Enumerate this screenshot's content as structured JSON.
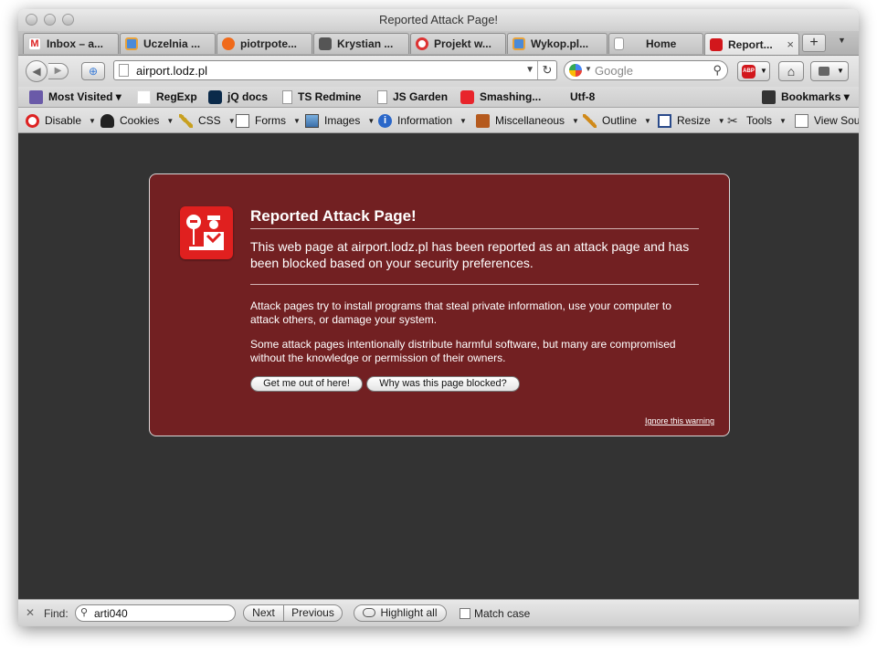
{
  "window": {
    "title": "Reported Attack Page!"
  },
  "tabs": [
    {
      "label": "Inbox – a..."
    },
    {
      "label": "Uczelnia ..."
    },
    {
      "label": "piotrpote..."
    },
    {
      "label": "Krystian ..."
    },
    {
      "label": "Projekt w..."
    },
    {
      "label": "Wykop.pl..."
    },
    {
      "label": "Home"
    },
    {
      "label": "Report..."
    }
  ],
  "tabbar": {
    "new_tab": "+",
    "close": "×"
  },
  "navbar": {
    "url": "airport.lodz.pl",
    "search_placeholder": "Google",
    "abp": "ABP"
  },
  "bookmarks": [
    {
      "label": "Most Visited ▾"
    },
    {
      "label": "RegExp"
    },
    {
      "label": "jQ docs"
    },
    {
      "label": "TS Redmine"
    },
    {
      "label": "JS Garden"
    },
    {
      "label": "Smashing..."
    },
    {
      "label": "Utf-8"
    },
    {
      "label": "Bookmarks ▾"
    }
  ],
  "devtoolbar": [
    {
      "label": "Disable"
    },
    {
      "label": "Cookies"
    },
    {
      "label": "CSS"
    },
    {
      "label": "Forms"
    },
    {
      "label": "Images"
    },
    {
      "label": "Information"
    },
    {
      "label": "Miscellaneous"
    },
    {
      "label": "Outline"
    },
    {
      "label": "Resize"
    },
    {
      "label": "Tools"
    },
    {
      "label": "View Sou"
    }
  ],
  "alert": {
    "title": "Reported Attack Page!",
    "short_desc": "This web page at airport.lodz.pl has been reported as an attack page and has been blocked based on your security preferences.",
    "long_desc_1": "Attack pages try to install programs that steal private information, use your computer to attack others, or damage your system.",
    "long_desc_2": "Some attack pages intentionally distribute harmful software, but many are compromised without the knowledge or permission of their owners.",
    "get_out_button": "Get me out of here!",
    "why_button": "Why was this page blocked?",
    "ignore_link": "Ignore this warning"
  },
  "findbar": {
    "label": "Find:",
    "value": "arti040",
    "next": "Next",
    "previous": "Previous",
    "highlight_all": "Highlight all",
    "match_case": "Match case"
  },
  "colors": {
    "alert_bg": "#722022",
    "alert_icon": "#e0201f",
    "content_bg": "#333333"
  }
}
